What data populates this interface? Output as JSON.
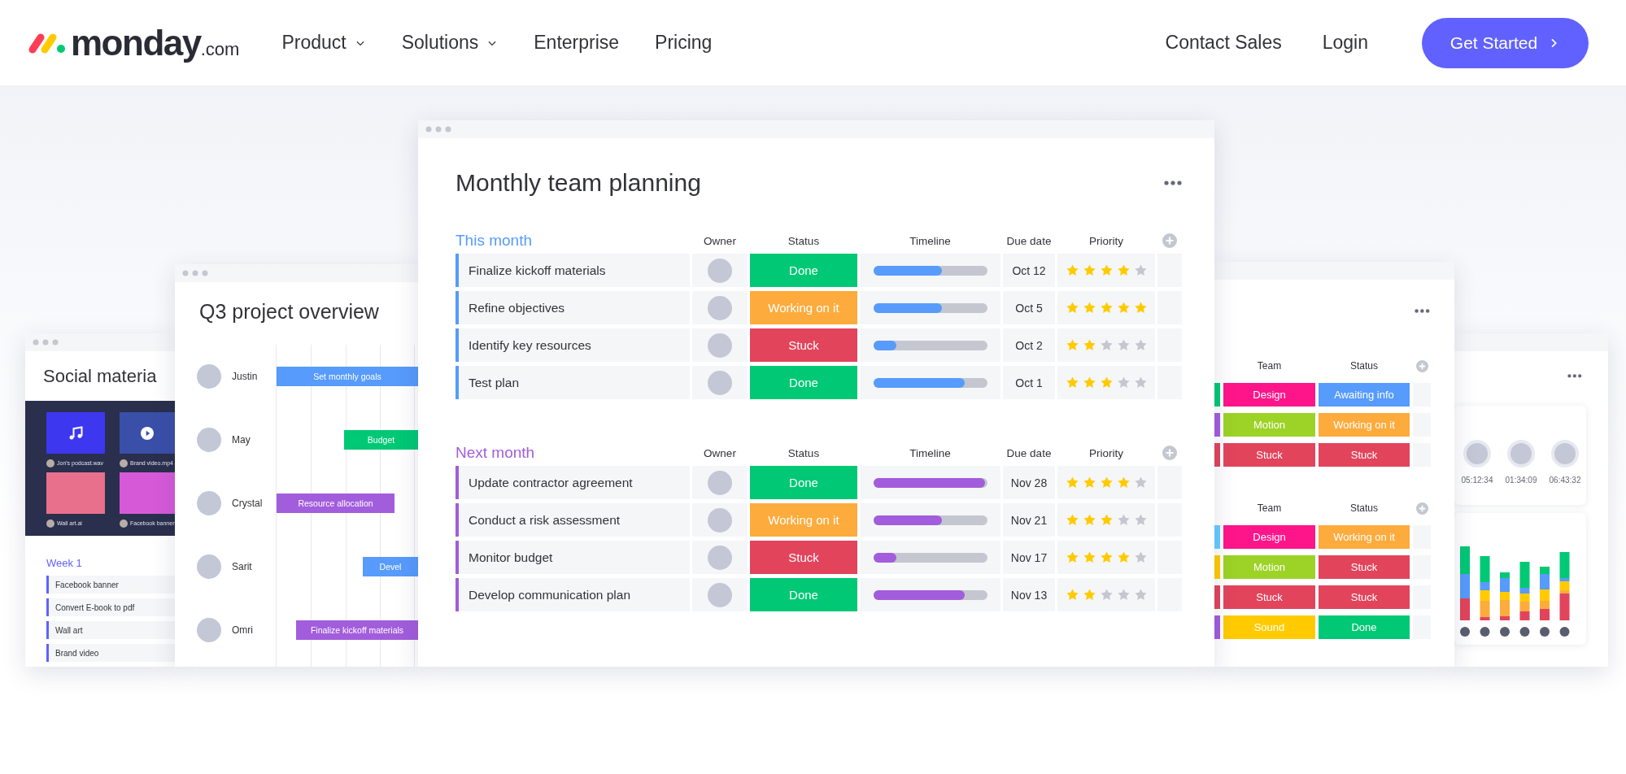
{
  "header": {
    "logo": {
      "name": "monday",
      "suffix": ".com"
    },
    "nav": [
      {
        "label": "Product",
        "has_menu": true
      },
      {
        "label": "Solutions",
        "has_menu": true
      },
      {
        "label": "Enterprise",
        "has_menu": false
      },
      {
        "label": "Pricing",
        "has_menu": false
      }
    ],
    "links": [
      "Contact Sales",
      "Login"
    ],
    "cta": "Get Started"
  },
  "social_board": {
    "title": "Social materia",
    "files": [
      {
        "kind": "audio",
        "caption": "Jon's podcast.wav"
      },
      {
        "kind": "video",
        "caption": "Brand video.mp4"
      },
      {
        "kind": "image",
        "caption": "Wall art.ai"
      },
      {
        "kind": "image",
        "caption": "Facebook banner"
      }
    ],
    "group": {
      "name": "Week 1",
      "color": "#6161ff",
      "items": [
        "Facebook banner",
        "Convert E-book to pdf",
        "Wall art",
        "Brand video"
      ]
    }
  },
  "gantt_board": {
    "title": "Q3 project overview",
    "rows": [
      {
        "person": "Justin",
        "task": "Set monthly goals",
        "color": "#579bfc"
      },
      {
        "person": "May",
        "task": "Budget",
        "color": "#00c875"
      },
      {
        "person": "Crystal",
        "task": "Resource allocation",
        "color": "#a25ddc"
      },
      {
        "person": "Sarit",
        "task": "Devel",
        "color": "#579bfc"
      },
      {
        "person": "Omri",
        "task": "Finalize kickoff materials",
        "color": "#a25ddc"
      }
    ]
  },
  "main_board": {
    "title": "Monthly team planning",
    "groups": [
      {
        "name": "This month",
        "color": "#579bfc",
        "columns": [
          "Owner",
          "Status",
          "Timeline",
          "Due date",
          "Priority"
        ],
        "items": [
          {
            "name": "Finalize kickoff materials",
            "status": {
              "label": "Done",
              "color": "#00c875"
            },
            "level": 0.6,
            "due": "Oct 12",
            "stars": 4
          },
          {
            "name": "Refine objectives",
            "status": {
              "label": "Working on it",
              "color": "#fdab3d"
            },
            "level": 0.6,
            "due": "Oct 5",
            "stars": 5
          },
          {
            "name": "Identify key resources",
            "status": {
              "label": "Stuck",
              "color": "#e2445c"
            },
            "level": 0.2,
            "due": "Oct 2",
            "stars": 2
          },
          {
            "name": "Test plan",
            "status": {
              "label": "Done",
              "color": "#00c875"
            },
            "level": 0.8,
            "due": "Oct 1",
            "stars": 3
          }
        ]
      },
      {
        "name": "Next month",
        "color": "#a25ddc",
        "columns": [
          "Owner",
          "Status",
          "Timeline",
          "Due date",
          "Priority"
        ],
        "items": [
          {
            "name": "Update contractor agreement",
            "status": {
              "label": "Done",
              "color": "#00c875"
            },
            "level": 1.0,
            "due": "Nov 28",
            "stars": 4
          },
          {
            "name": "Conduct a risk assessment",
            "status": {
              "label": "Working on it",
              "color": "#fdab3d"
            },
            "level": 0.6,
            "due": "Nov  21",
            "stars": 3
          },
          {
            "name": "Monitor budget",
            "status": {
              "label": "Stuck",
              "color": "#e2445c"
            },
            "level": 0.2,
            "due": "Nov  17",
            "stars": 4
          },
          {
            "name": "Develop communication plan",
            "status": {
              "label": "Done",
              "color": "#00c875"
            },
            "level": 0.8,
            "due": "Nov  13",
            "stars": 2
          }
        ]
      }
    ]
  },
  "team_board": {
    "groups": [
      {
        "columns": [
          "Team",
          "Status"
        ],
        "rows": [
          {
            "color": "#00c875",
            "team": {
              "label": "Design",
              "color": "#ff158a"
            },
            "status": {
              "label": "Awaiting info",
              "color": "#579bfc"
            }
          },
          {
            "color": "#a25ddc",
            "team": {
              "label": "Motion",
              "color": "#9cd326"
            },
            "status": {
              "label": "Working on it",
              "color": "#fdab3d"
            }
          },
          {
            "color": "#e2445c",
            "team": {
              "label": "Stuck",
              "color": "#e2445c"
            },
            "status": {
              "label": "Stuck",
              "color": "#e2445c"
            }
          }
        ]
      },
      {
        "columns": [
          "Team",
          "Status"
        ],
        "rows": [
          {
            "color": "#66ccff",
            "team": {
              "label": "Design",
              "color": "#ff158a"
            },
            "status": {
              "label": "Working on it",
              "color": "#fdab3d"
            }
          },
          {
            "color": "#ffcb00",
            "team": {
              "label": "Motion",
              "color": "#9cd326"
            },
            "status": {
              "label": "Stuck",
              "color": "#e2445c"
            }
          },
          {
            "color": "#e2445c",
            "team": {
              "label": "Stuck",
              "color": "#e2445c"
            },
            "status": {
              "label": "Stuck",
              "color": "#e2445c"
            }
          },
          {
            "color": "#a25ddc",
            "team": {
              "label": "Sound",
              "color": "#ffcb00"
            },
            "status": {
              "label": "Done",
              "color": "#00c875"
            }
          }
        ]
      }
    ]
  },
  "time_board": {
    "timers": [
      "05:12:34",
      "01:34:09",
      "06:43:32"
    ]
  }
}
